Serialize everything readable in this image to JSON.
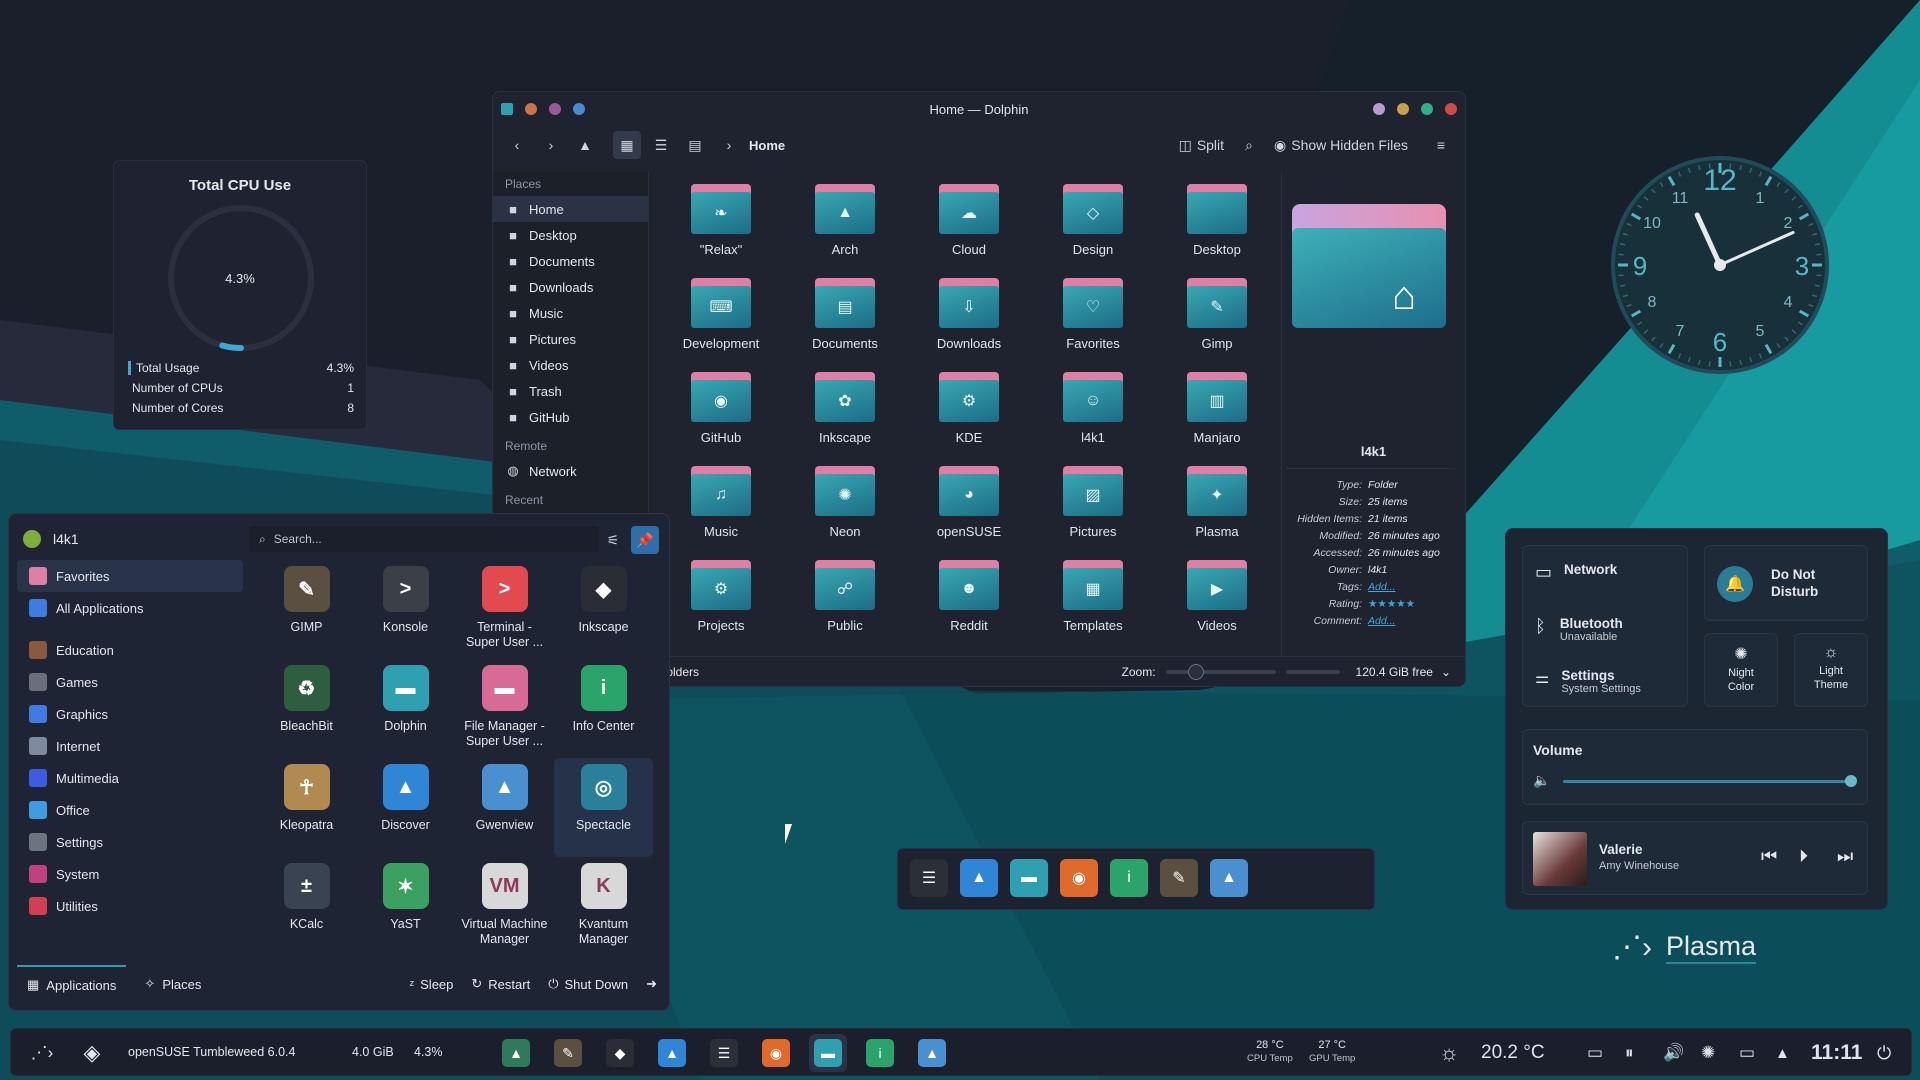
{
  "colors": {
    "accent": "#1b8a93",
    "pink": "#e07fa6",
    "panel": "#1a1f2b",
    "text": "#e4e8ee"
  },
  "cpu_widget": {
    "title": "Total CPU Use",
    "percent": "4.3%",
    "usage_fraction": 0.043,
    "rows": [
      {
        "label": "Total Usage",
        "value": "4.3%"
      },
      {
        "label": "Number of CPUs",
        "value": "1"
      },
      {
        "label": "Number of Cores",
        "value": "8"
      }
    ]
  },
  "dolphin": {
    "title": "Home — Dolphin",
    "breadcrumb": "Home",
    "toolbar": {
      "split": "Split",
      "show_hidden": "Show Hidden Files"
    },
    "places": {
      "header": "Places",
      "items": [
        {
          "label": "Home",
          "icon": "home-icon"
        },
        {
          "label": "Desktop",
          "icon": "desktop-icon"
        },
        {
          "label": "Documents",
          "icon": "documents-icon"
        },
        {
          "label": "Downloads",
          "icon": "downloads-icon"
        },
        {
          "label": "Music",
          "icon": "music-icon"
        },
        {
          "label": "Pictures",
          "icon": "pictures-icon"
        },
        {
          "label": "Videos",
          "icon": "videos-icon"
        },
        {
          "label": "Trash",
          "icon": "trash-icon"
        },
        {
          "label": "GitHub",
          "icon": "github-icon"
        }
      ],
      "remote_header": "Remote",
      "remote_items": [
        {
          "label": "Network",
          "icon": "network-icon"
        }
      ],
      "recent_header": "Recent"
    },
    "files": [
      {
        "name": "\"Relax\"",
        "glyph": "❧"
      },
      {
        "name": "Arch",
        "glyph": "▲"
      },
      {
        "name": "Cloud",
        "glyph": "☁"
      },
      {
        "name": "Design",
        "glyph": "◇"
      },
      {
        "name": "Desktop",
        "glyph": ""
      },
      {
        "name": "Development",
        "glyph": "⌨"
      },
      {
        "name": "Documents",
        "glyph": "▤"
      },
      {
        "name": "Downloads",
        "glyph": "⇩"
      },
      {
        "name": "Favorites",
        "glyph": "♡"
      },
      {
        "name": "Gimp",
        "glyph": "✎"
      },
      {
        "name": "GitHub",
        "glyph": "◉"
      },
      {
        "name": "Inkscape",
        "glyph": "✿"
      },
      {
        "name": "KDE",
        "glyph": "⚙"
      },
      {
        "name": "l4k1",
        "glyph": "☺"
      },
      {
        "name": "Manjaro",
        "glyph": "▥"
      },
      {
        "name": "Music",
        "glyph": "♫"
      },
      {
        "name": "Neon",
        "glyph": "✺"
      },
      {
        "name": "openSUSE",
        "glyph": "◕"
      },
      {
        "name": "Pictures",
        "glyph": "▨"
      },
      {
        "name": "Plasma",
        "glyph": "✦"
      },
      {
        "name": "Projects",
        "glyph": "⚙"
      },
      {
        "name": "Public",
        "glyph": "☍"
      },
      {
        "name": "Reddit",
        "glyph": "☻"
      },
      {
        "name": "Templates",
        "glyph": "▦"
      },
      {
        "name": "Videos",
        "glyph": "▶"
      }
    ],
    "info": {
      "name": "l4k1",
      "rows": [
        {
          "k": "Type:",
          "v": "Folder"
        },
        {
          "k": "Size:",
          "v": "25 items"
        },
        {
          "k": "Hidden Items:",
          "v": "21 items"
        },
        {
          "k": "Modified:",
          "v": "26 minutes ago"
        },
        {
          "k": "Accessed:",
          "v": "26 minutes ago"
        },
        {
          "k": "Owner:",
          "v": "l4k1"
        },
        {
          "k": "Tags:",
          "v": "Add..."
        },
        {
          "k": "Rating:",
          "v": "★★★★★"
        },
        {
          "k": "Comment:",
          "v": "Add..."
        }
      ]
    },
    "status": {
      "left": "folders",
      "zoom_label": "Zoom:",
      "free": "120.4 GiB free"
    }
  },
  "launcher": {
    "user": "l4k1",
    "search_placeholder": "Search...",
    "categories": [
      {
        "label": "Favorites",
        "color": "#e07fa6"
      },
      {
        "label": "All Applications",
        "color": "#3d7de0"
      },
      {
        "label": "Education",
        "color": "#8b5a3c"
      },
      {
        "label": "Games",
        "color": "#6a6f7a"
      },
      {
        "label": "Graphics",
        "color": "#3d7de0"
      },
      {
        "label": "Internet",
        "color": "#7d8aa0"
      },
      {
        "label": "Multimedia",
        "color": "#3d5de0"
      },
      {
        "label": "Office",
        "color": "#3d9de0"
      },
      {
        "label": "Settings",
        "color": "#6d7480"
      },
      {
        "label": "System",
        "color": "#c04080"
      },
      {
        "label": "Utilities",
        "color": "#d04050"
      }
    ],
    "apps": [
      {
        "label": "GIMP",
        "color": "#5a4f40",
        "glyph": "✎"
      },
      {
        "label": "Konsole",
        "color": "#3a3f48",
        "glyph": ">"
      },
      {
        "label": "Terminal -\nSuper User ...",
        "color": "#e24a50",
        "glyph": ">"
      },
      {
        "label": "Inkscape",
        "color": "#2a2d35",
        "glyph": "◆"
      },
      {
        "label": "BleachBit",
        "color": "#2f5d3f",
        "glyph": "♻"
      },
      {
        "label": "Dolphin",
        "color": "#2f9fb2",
        "glyph": "▬"
      },
      {
        "label": "File Manager -\nSuper User ...",
        "color": "#d86a96",
        "glyph": "▬"
      },
      {
        "label": "Info Center",
        "color": "#2aa46a",
        "glyph": "i"
      },
      {
        "label": "Kleopatra",
        "color": "#b08a50",
        "glyph": "☥"
      },
      {
        "label": "Discover",
        "color": "#2f86d6",
        "glyph": "▲"
      },
      {
        "label": "Gwenview",
        "color": "#4a8fd0",
        "glyph": "▲"
      },
      {
        "label": "Spectacle",
        "color": "#2a7f9a",
        "glyph": "◎"
      },
      {
        "label": "KCalc",
        "color": "#3a4352",
        "glyph": "±"
      },
      {
        "label": "YaST",
        "color": "#3aa15e",
        "glyph": "✶"
      },
      {
        "label": "Virtual Machine\nManager",
        "color": "#d8d8d8",
        "glyph": "VM"
      },
      {
        "label": "Kvantum\nManager",
        "color": "#d8d8d8",
        "glyph": "K"
      }
    ],
    "footer": {
      "applications": "Applications",
      "places": "Places",
      "sleep": "Sleep",
      "restart": "Restart",
      "shutdown": "Shut Down"
    }
  },
  "clock": {
    "time": "11:11",
    "hour": 11,
    "minute": 11
  },
  "quick_settings": {
    "network": "Network",
    "bluetooth": {
      "label": "Bluetooth",
      "sub": "Unavailable"
    },
    "settings": {
      "label": "Settings",
      "sub": "System Settings"
    },
    "dnd": "Do Not\nDisturb",
    "night": "Night\nColor",
    "light": "Light\nTheme",
    "volume": {
      "label": "Volume",
      "level": 1.0
    },
    "media": {
      "title": "Valerie",
      "artist": "Amy Winehouse"
    },
    "plasma": "Plasma"
  },
  "panel": {
    "distro": "openSUSE Tumbleweed 6.0.4",
    "mem": "4.0 GiB",
    "cpu": "4.3%",
    "cpu_temp": {
      "v": "28 °C",
      "l": "CPU Temp"
    },
    "gpu_temp": {
      "v": "27 °C",
      "l": "GPU Temp"
    },
    "weather": "20.2 °C",
    "time": "11:11"
  }
}
